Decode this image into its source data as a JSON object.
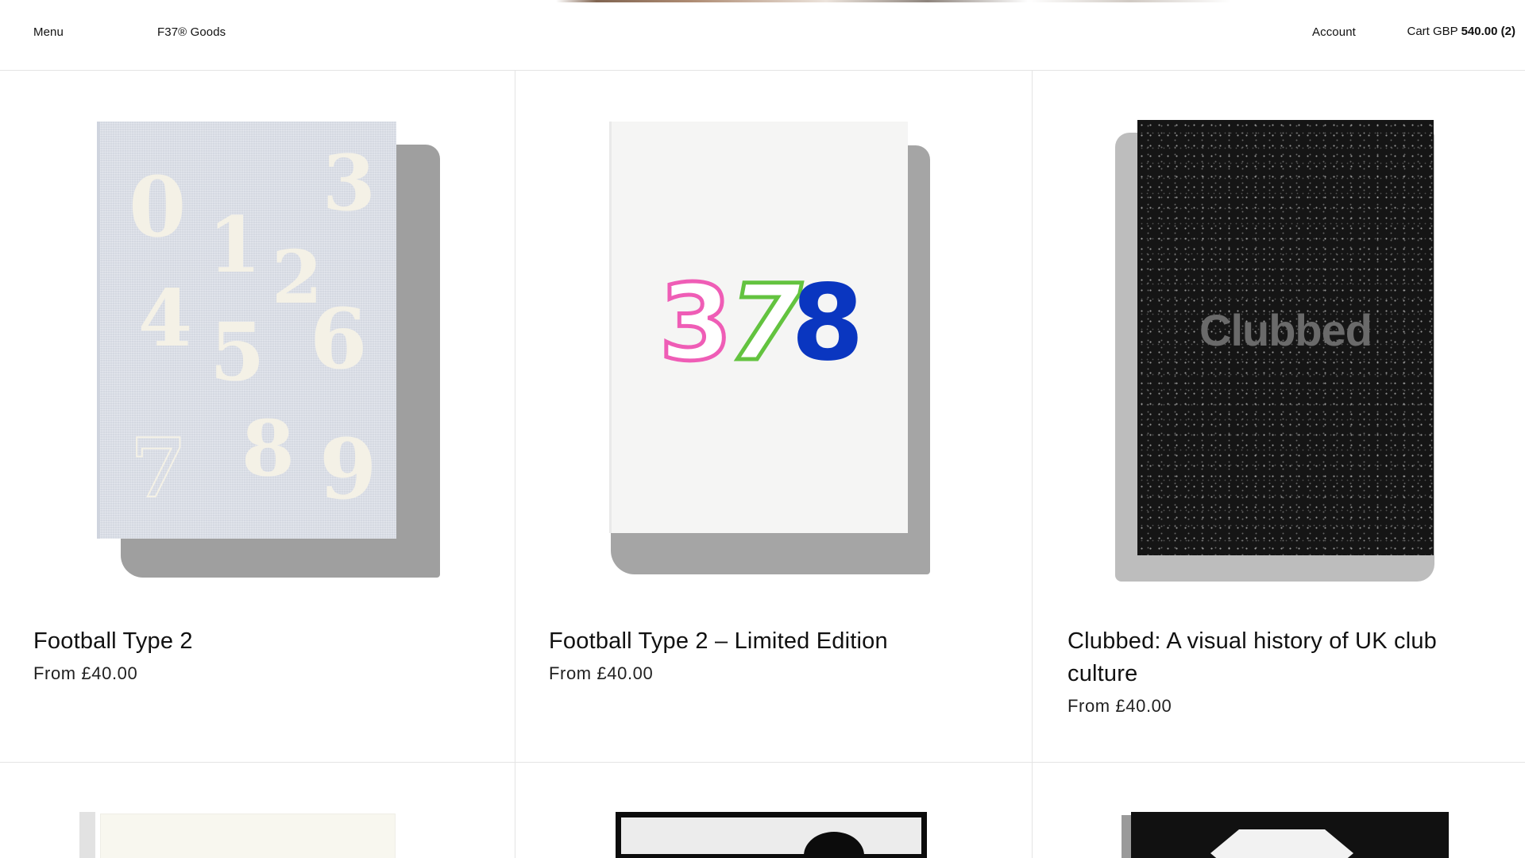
{
  "header": {
    "menu_label": "Menu",
    "brand_label": "F37® Goods",
    "account_label": "Account",
    "cart_prefix": "Cart GBP",
    "cart_total": "540.00",
    "cart_count": "(2)"
  },
  "products": [
    {
      "title": "Football Type 2",
      "price": "From £40.00",
      "cover_numbers": [
        "0",
        "1",
        "2",
        "3",
        "4",
        "5",
        "6",
        "7",
        "8",
        "9"
      ]
    },
    {
      "title": "Football Type 2 – Limited Edition",
      "price": "From £40.00",
      "cover_digits": [
        "3",
        "7",
        "8"
      ],
      "digit_colors": [
        "#ef5db6",
        "#63c33f",
        "#0a36c0"
      ]
    },
    {
      "title": "Clubbed: A visual history of UK club culture",
      "price": "From £40.00",
      "cover_text": "Clubbed"
    }
  ],
  "colors": {
    "border": "#e4e4e4",
    "text": "#111111"
  }
}
